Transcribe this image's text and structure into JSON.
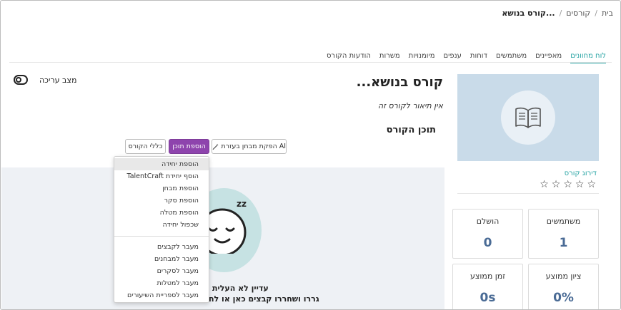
{
  "breadcrumb": {
    "items": [
      "בית",
      "קורסים",
      "קורס בנושא..."
    ]
  },
  "tabs": [
    {
      "label": "לוח מחוונים",
      "active": true
    },
    {
      "label": "מאפיינים",
      "active": false
    },
    {
      "label": "משתמשים",
      "active": false
    },
    {
      "label": "דוחות",
      "active": false
    },
    {
      "label": "ענפים",
      "active": false
    },
    {
      "label": "מיומנויות",
      "active": false
    },
    {
      "label": "משרות",
      "active": false
    },
    {
      "label": "הודעות הקורס",
      "active": false
    }
  ],
  "course": {
    "title": "קורס בנושא...",
    "description": "אין תיאור לקורס זה",
    "content_heading": "תוכן הקורס"
  },
  "edit_mode": {
    "label": "מצב עריכה"
  },
  "buttons": {
    "ai_quiz": "הפקת מבחן בעזרת AI",
    "add_content": "הוספת תוכן",
    "course_tools": "כללי הקורס"
  },
  "dropdown": {
    "items": [
      "הוספת יחידה",
      "הוסף יחידת TalentCraft",
      "הוספת מבחן",
      "הוספת סקר",
      "הוספת מטלה",
      "שכפול יחידה"
    ],
    "nav_items": [
      "מעבר לקבצים",
      "מעבר למבחנים",
      "מעבר לסקרים",
      "מעבר למטלות",
      "מעבר לספריית השיעורים"
    ]
  },
  "empty_state": {
    "line1": "עדיין לא העלית",
    "line2": "גררו ושחררו קבצים כאן או לח",
    "zz": "zz"
  },
  "sidebar": {
    "rating_link": "דירוג קורס",
    "stars": [
      "☆",
      "☆",
      "☆",
      "☆",
      "☆"
    ],
    "stats": {
      "users_label": "משתמשים",
      "users_value": "1",
      "completed_label": "הושלם",
      "completed_value": "0",
      "avg_grade_label": "ציון ממוצע",
      "avg_grade_value": "0%",
      "avg_time_label": "זמן ממוצע",
      "avg_time_value": "0s"
    }
  },
  "colors": {
    "accent": "#2aa5a5",
    "primary_button": "#8e44ad",
    "stat_value": "#4a6b95"
  }
}
